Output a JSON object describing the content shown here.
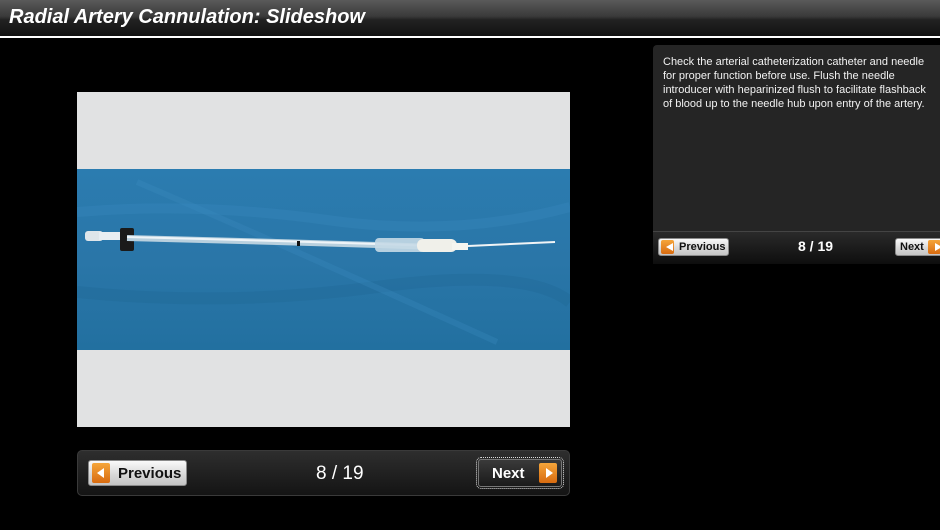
{
  "app": {
    "title": "Radial Artery Cannulation: Slideshow"
  },
  "slide": {
    "description": "Check the arterial catheterization catheter and needle for proper function before use. Flush the needle introducer with heparinized flush to facilitate flashback of blood up to the needle hub upon entry of the artery.",
    "current": 8,
    "total": 19,
    "counter_text": "8 / 19"
  },
  "main_nav": {
    "previous_label": "Previous",
    "next_label": "Next",
    "counter": "8 / 19"
  },
  "side_nav": {
    "previous_label": "Previous",
    "next_label": "Next",
    "counter": "8 / 19"
  },
  "colors": {
    "accent_arrow": "#e57f1c",
    "drape_blue": "#2a78a8",
    "panel_bg": "#252525"
  },
  "icons": [
    "chevron-left-icon",
    "chevron-right-icon"
  ]
}
